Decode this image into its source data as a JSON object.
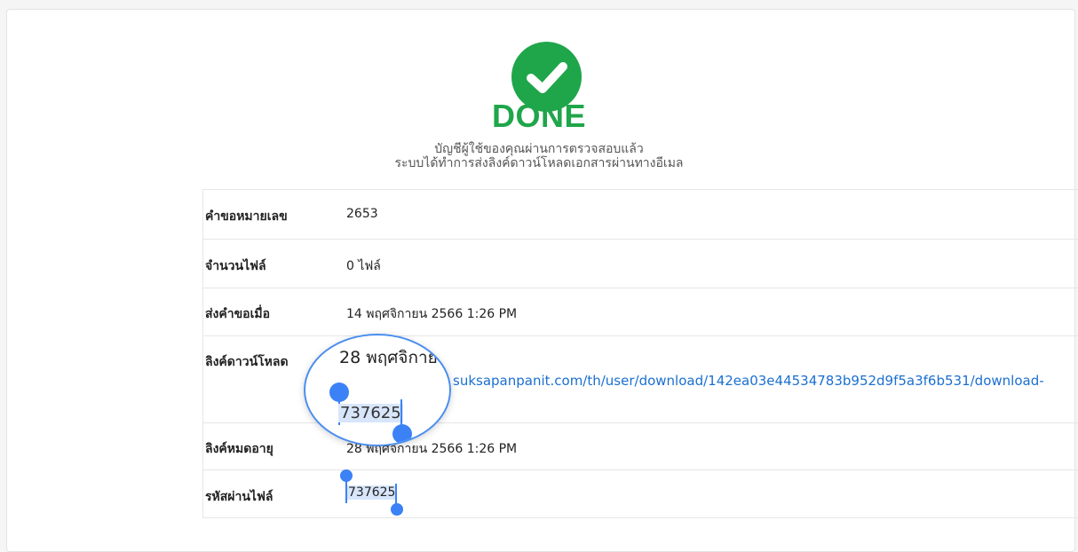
{
  "status": {
    "title": "DONE",
    "message_line1": "บัญชีผู้ใช้ของคุณผ่านการตรวจสอบแล้ว",
    "message_line2": "ระบบได้ทำการส่งลิงค์ดาวน์โหลดเอกสารผ่านทางอีเมล",
    "icon": "checkmark-circle-icon",
    "accent_color": "#1fa64a"
  },
  "details": {
    "request_number": {
      "label": "คำขอหมายเลข",
      "value": "2653"
    },
    "file_count": {
      "label": "จำนวนไฟล์",
      "value": "0 ไฟล์"
    },
    "submitted_at": {
      "label": "ส่งคำขอเมื่อ",
      "value": "14 พฤศจิกายน 2566 1:26 PM"
    },
    "download_link": {
      "label": "ลิงค์ดาวน์โหลด",
      "value": "suksapanpanit.com/th/user/download/142ea03e44534783b952d9f5a3f6b531/download-"
    },
    "link_expiry": {
      "label": "ลิงค์หมดอายุ",
      "value": "28 พฤศจิกายน 2566 1:26 PM"
    },
    "file_password": {
      "label": "รหัสผ่านไฟล์",
      "value": "737625"
    }
  },
  "magnifier": {
    "date_text": "28 พฤศจิกาย",
    "selected_text": "737625"
  },
  "link_color": "#1b6fd1",
  "selection_color": "#3b82f6"
}
